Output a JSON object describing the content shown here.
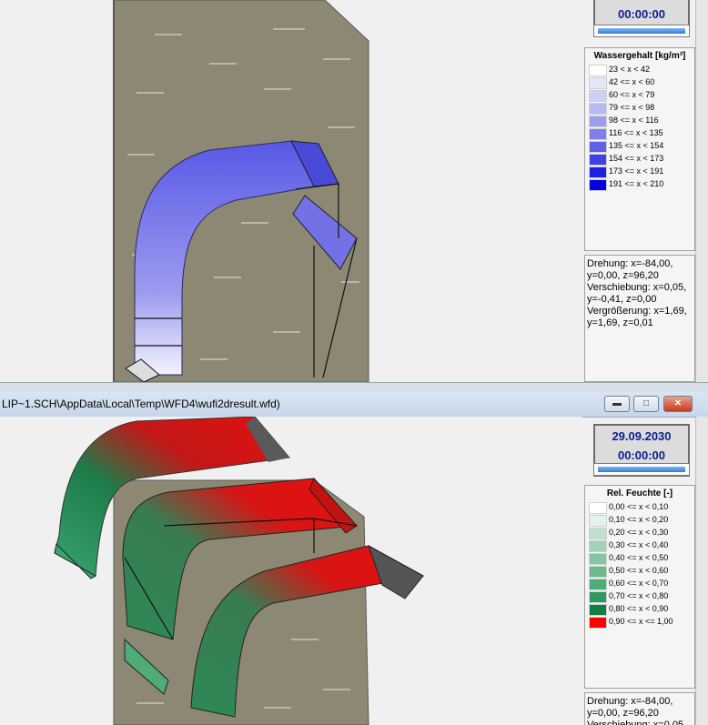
{
  "top_window": {
    "clock": {
      "time": "00:00:00"
    },
    "legend": {
      "title": "Wassergehalt [kg/m³]",
      "items": [
        {
          "label": "23 < x < 42",
          "color": "#ffffff"
        },
        {
          "label": "42 <= x < 60",
          "color": "#e6e6fb"
        },
        {
          "label": "60 <= x < 79",
          "color": "#cfcff6"
        },
        {
          "label": "79 <= x < 98",
          "color": "#b8b8f2"
        },
        {
          "label": "98 <= x < 116",
          "color": "#9e9eee"
        },
        {
          "label": "116 <= x < 135",
          "color": "#7f7feb"
        },
        {
          "label": "135 <= x < 154",
          "color": "#5f5fe8"
        },
        {
          "label": "154 <= x < 173",
          "color": "#4040e6"
        },
        {
          "label": "173 <= x < 191",
          "color": "#2020e3"
        },
        {
          "label": "191 <= x < 210",
          "color": "#0000e0"
        }
      ]
    },
    "info_lines": "Drehung: x=-84,00,\ny=0,00, z=96,20\nVerschiebung: x=0,05,\ny=-0,41, z=0,00\nVergrößerung: x=1,69,\ny=1,69, z=0,01"
  },
  "bottom_window": {
    "title": "LIP~1.SCH\\AppData\\Local\\Temp\\WFD4\\wufi2dresult.wfd)",
    "clock": {
      "date": "29.09.2030",
      "time": "00:00:00"
    },
    "legend": {
      "title": "Rel. Feuchte [-]",
      "items": [
        {
          "label": "0,00 <= x < 0,10",
          "color": "#ffffff"
        },
        {
          "label": "0,10 <= x < 0,20",
          "color": "#e3f1ea"
        },
        {
          "label": "0,20 <= x < 0,30",
          "color": "#bfe0cf"
        },
        {
          "label": "0,30 <= x < 0,40",
          "color": "#a2d2b8"
        },
        {
          "label": "0,40 <= x < 0,50",
          "color": "#86c5a2"
        },
        {
          "label": "0,50 <= x < 0,60",
          "color": "#6bb98d"
        },
        {
          "label": "0,60 <= x < 0,70",
          "color": "#4fac78"
        },
        {
          "label": "0,70 <= x < 0,80",
          "color": "#2f9a60"
        },
        {
          "label": "0,80 <= x < 0,90",
          "color": "#117f43"
        },
        {
          "label": "0,90 <= x <= 1,00",
          "color": "#ff0000"
        }
      ]
    },
    "info_lines": "Drehung: x=-84,00,\ny=0,00, z=96,20\nVerschiebung: x=0,05"
  },
  "colors": {
    "wall": "#8c8874",
    "titlebar": "#c6d6ea",
    "close_button": "#c53a1f"
  },
  "icons": {
    "minimize": "minimize-icon",
    "maximize": "maximize-icon",
    "close": "close-icon"
  }
}
